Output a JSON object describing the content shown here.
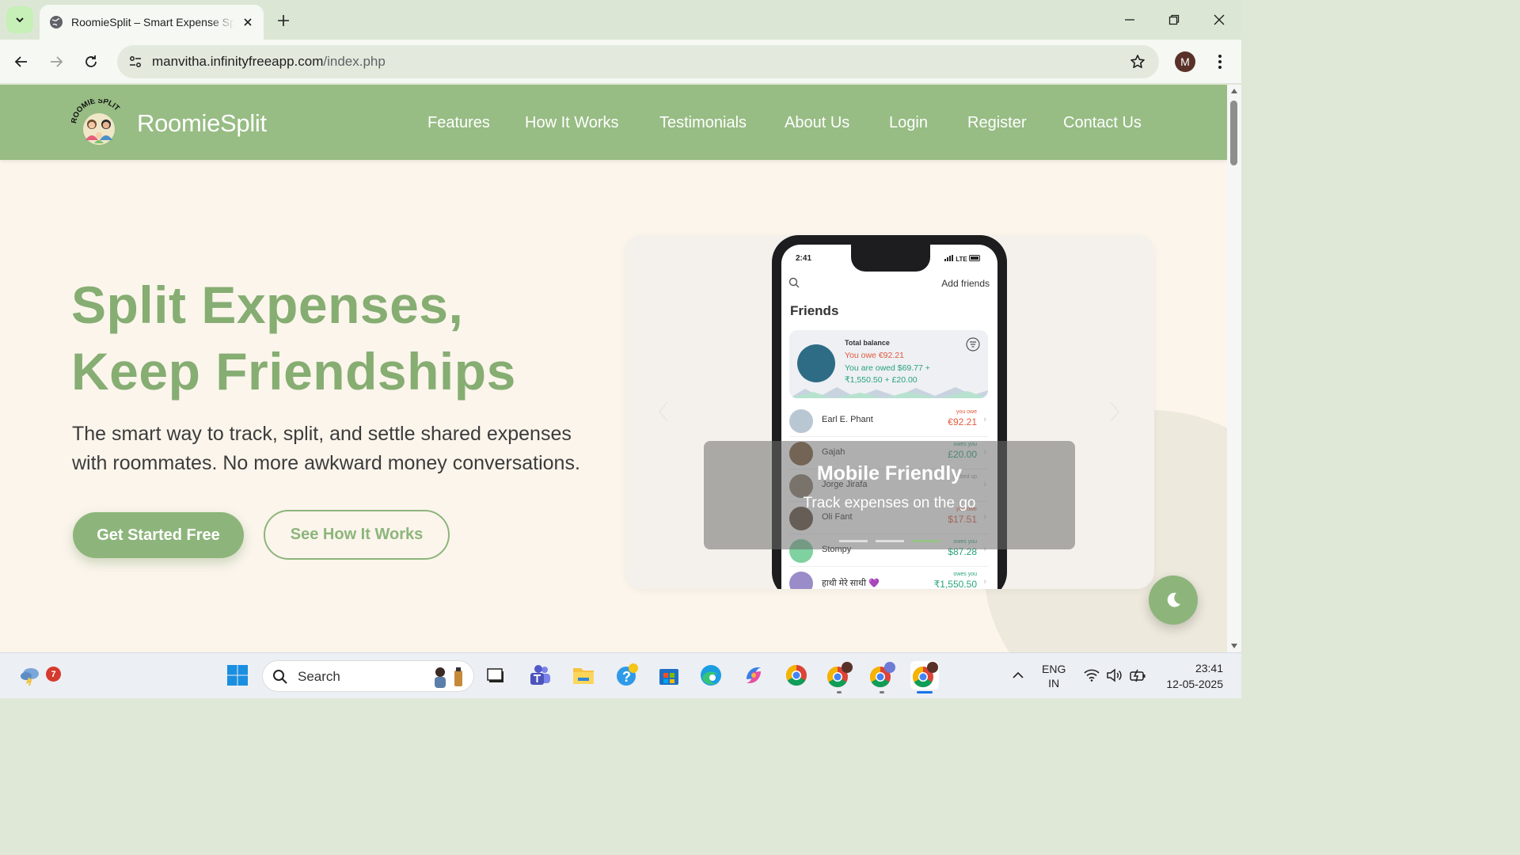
{
  "browser": {
    "tab_title": "RoomieSplit – Smart Expense Sp",
    "url_host": "manvitha.infinityfreeapp.com",
    "url_path": "/index.php",
    "profile_initial": "M"
  },
  "site": {
    "brand": "RoomieSplit",
    "logo_text": "ROOMIE SPLIT",
    "nav": [
      "Features",
      "How It Works",
      "Testimonials",
      "About Us",
      "Login",
      "Register",
      "Contact Us"
    ],
    "hero_title_line1": "Split Expenses,",
    "hero_title_line2": "Keep Friendships",
    "hero_subtitle": "The smart way to track, split, and settle shared expenses with roommates. No more awkward money conversations.",
    "cta_primary": "Get Started Free",
    "cta_secondary": "See How It Works",
    "carousel": {
      "caption_title": "Mobile Friendly",
      "caption_sub": "Track expenses on the go",
      "slide_count": 3,
      "active_slide": 3
    },
    "phone": {
      "time": "2:41",
      "status": "LTE",
      "add_friends": "Add friends",
      "heading": "Friends",
      "total_balance": "Total balance",
      "you_owe": "You owe €92.21",
      "you_are_owed": "You are owed $69.77 + ₹1,550.50 + £20.00",
      "rows": [
        {
          "name": "Earl E. Phant",
          "status": "you owe",
          "amount": "€92.21",
          "color": "#e2583e"
        },
        {
          "name": "Gajah",
          "status": "owes you",
          "amount": "£20.00",
          "color": "#29a37a"
        },
        {
          "name": "Jorge Jirafa",
          "status": "settled up",
          "amount": "",
          "color": "#999999"
        },
        {
          "name": "Oli Fant",
          "status": "you owe",
          "amount": "$17.51",
          "color": "#e2583e"
        },
        {
          "name": "Stompy",
          "status": "owes you",
          "amount": "$87.28",
          "color": "#29a37a"
        },
        {
          "name": "हाथी मेरे साथी 💜",
          "status": "owes you",
          "amount": "₹1,550.50",
          "color": "#29a37a"
        }
      ]
    }
  },
  "taskbar": {
    "search_placeholder": "Search",
    "weather_badge": "7",
    "lang_line1": "ENG",
    "lang_line2": "IN",
    "time": "23:41",
    "date": "12-05-2025"
  },
  "colors": {
    "accent_green": "#97bc84",
    "hero_green": "#86ad72",
    "page_bg": "#fbf5ec"
  }
}
